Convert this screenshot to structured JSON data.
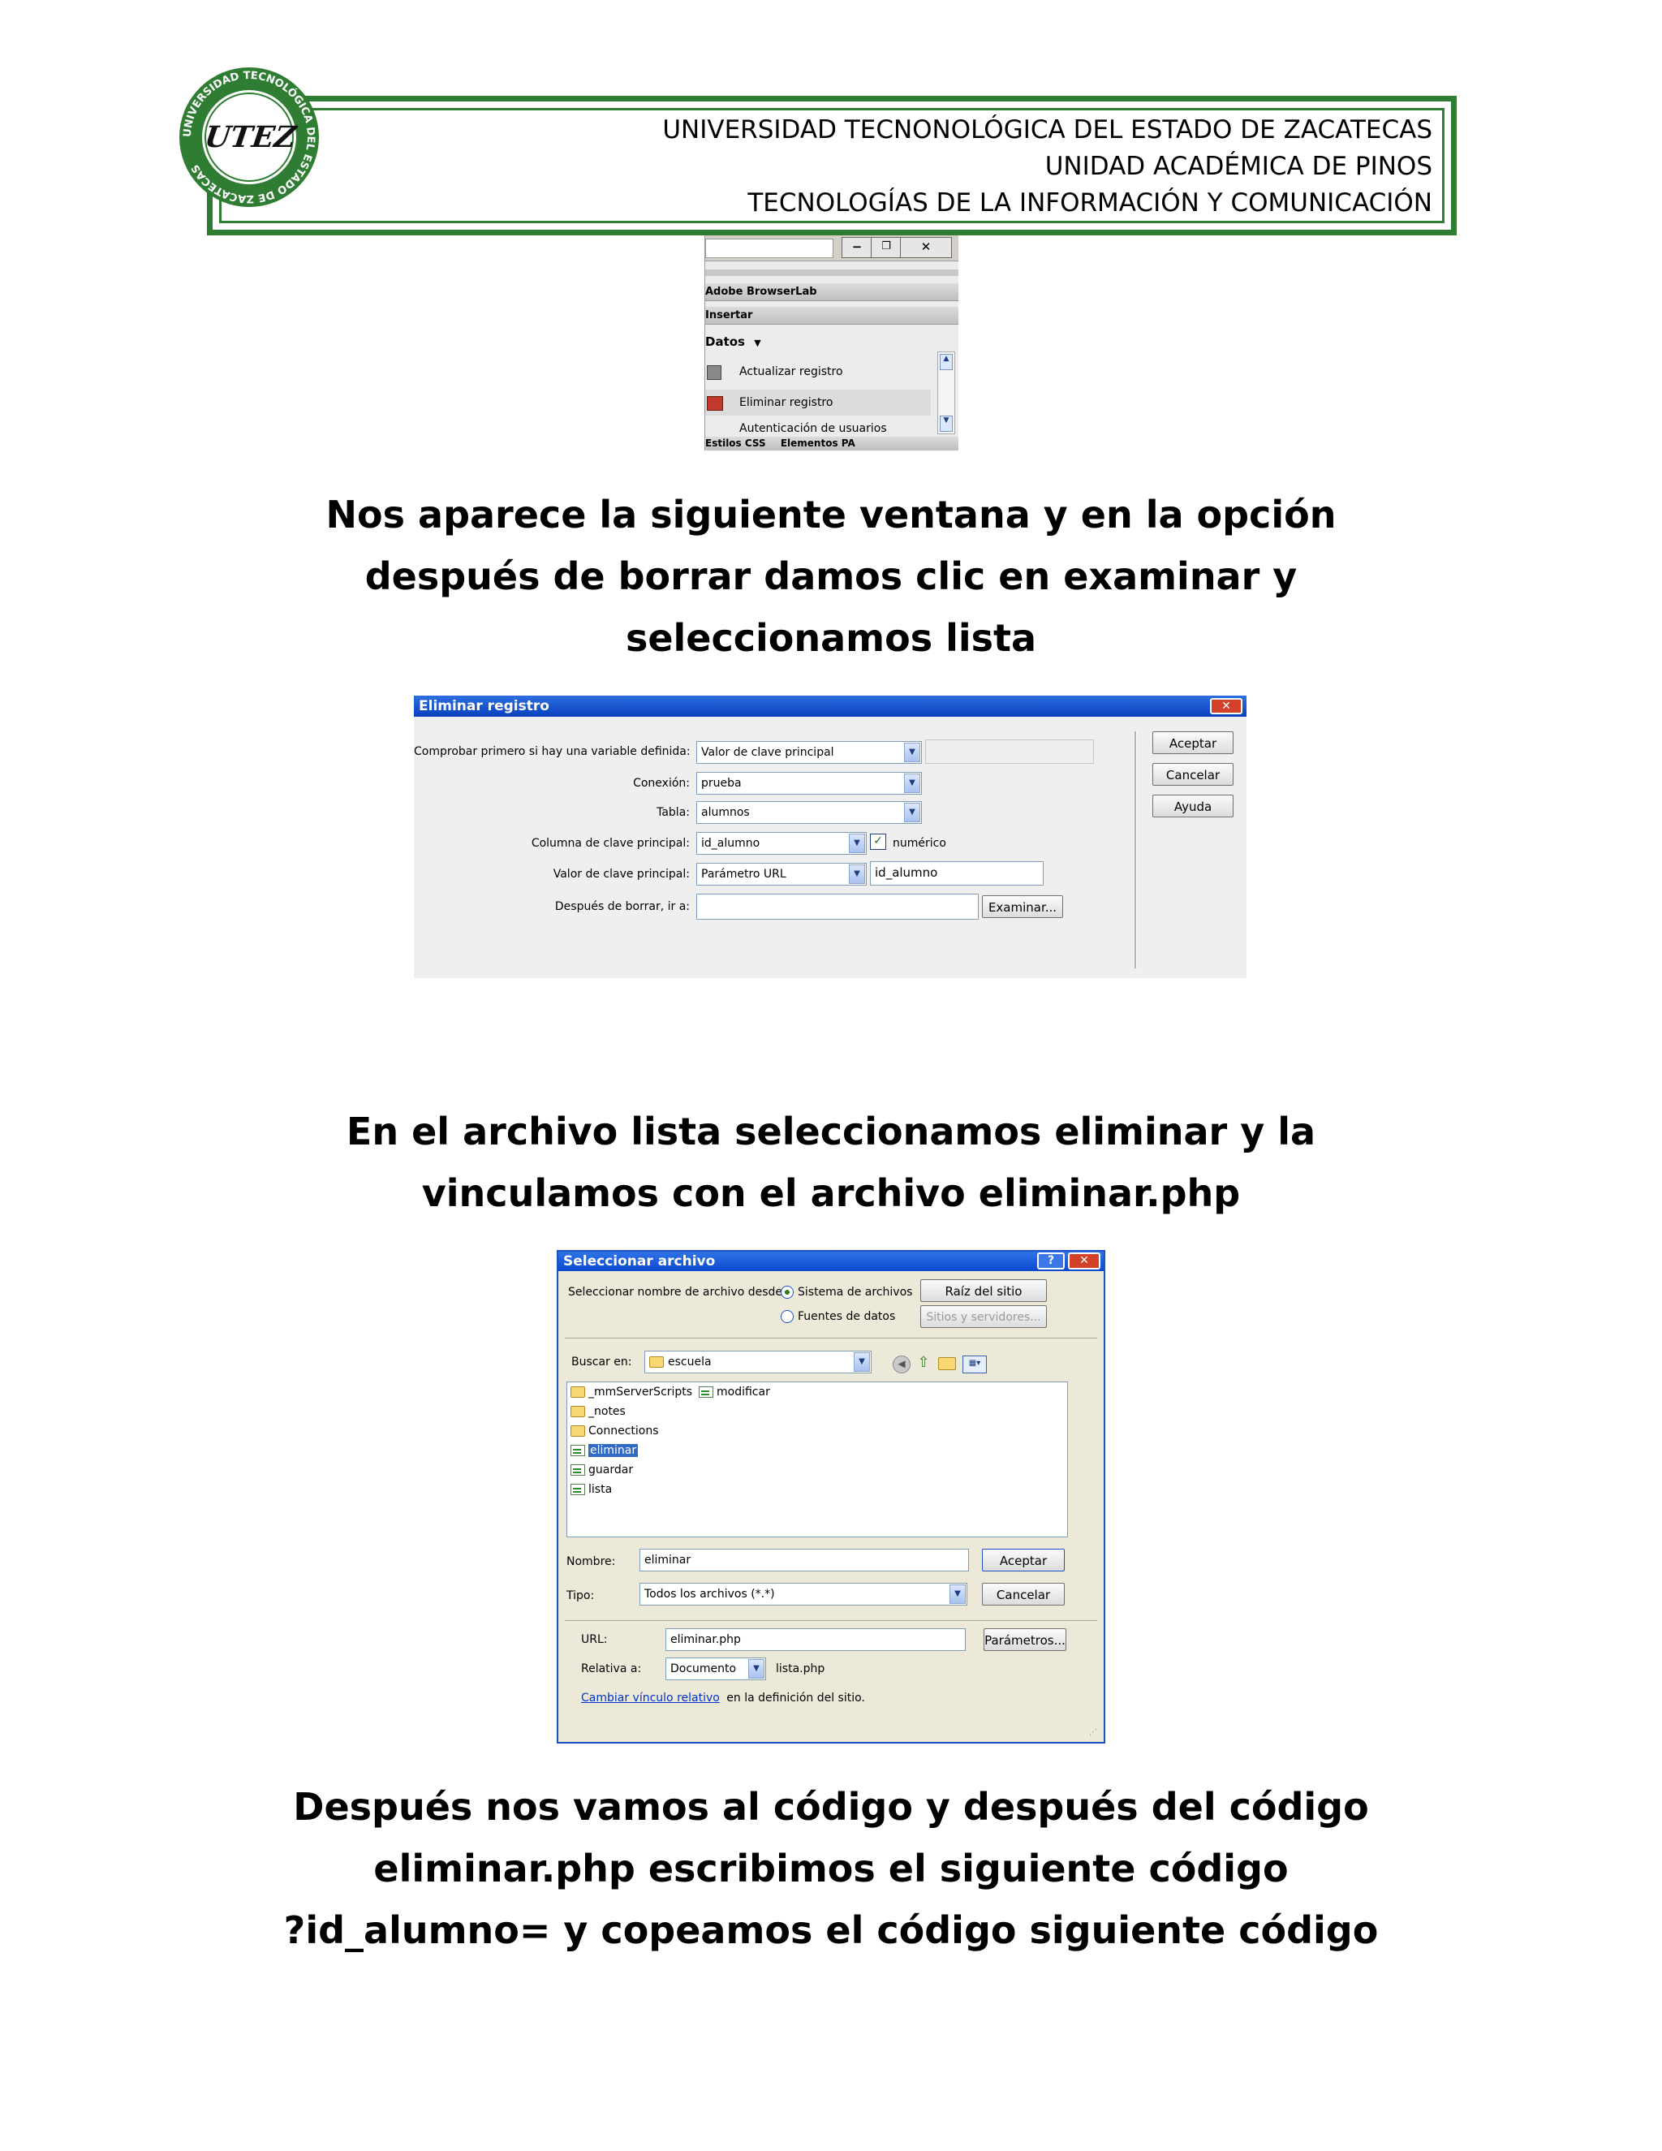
{
  "header": {
    "line1": "UNIVERSIDAD TECNONOLÓGICA DEL ESTADO DE ZACATECAS",
    "line2": "UNIDAD ACADÉMICA DE PINOS",
    "line3": "TECNOLOGÍAS DE LA INFORMACIÓN Y COMUNICACIÓN",
    "logo_ring_text": "UNIVERSIDAD TECNOLÓGICA DEL ESTADO DE ZACATECAS",
    "logo_text": "UTEZ",
    "accent_color": "#2e7d32"
  },
  "panel": {
    "browserlab": "Adobe BrowserLab",
    "insertar": "Insertar",
    "datos": "Datos",
    "items": [
      "Actualizar registro",
      "Eliminar registro",
      "Autenticación de usuarios"
    ],
    "tabs": [
      "Estilos CSS",
      "Elementos PA"
    ]
  },
  "paragraphs": {
    "p1": [
      "Nos  aparece la  siguiente   ventana y  en la  opción",
      "después de  borrar damos clic  en examinar y",
      "seleccionamos lista"
    ],
    "p2": [
      "En el archivo  lista  seleccionamos eliminar  y  la",
      "vinculamos   con el  archivo eliminar.php"
    ],
    "p3": [
      "Después nos   vamos al  código y  después  del  código",
      "eliminar.php escribimos  el siguiente  código",
      "?id_alumno= y  copeamos  el  código  siguiente  código"
    ]
  },
  "dialog1": {
    "title": "Eliminar registro",
    "labels": {
      "check_var": "Comprobar primero si hay una variable definida:",
      "conexion": "Conexión:",
      "tabla": "Tabla:",
      "columna": "Columna de clave principal:",
      "valor": "Valor de clave principal:",
      "despues": "Después de borrar, ir a:"
    },
    "values": {
      "check_var": "Valor de clave principal",
      "conexion": "prueba",
      "tabla": "alumnos",
      "columna": "id_alumno",
      "numerico": "numérico",
      "valor": "Parámetro URL",
      "valor_param": "id_alumno",
      "despues": ""
    },
    "buttons": {
      "examinar": "Examinar...",
      "aceptar": "Aceptar",
      "cancelar": "Cancelar",
      "ayuda": "Ayuda"
    }
  },
  "dialog2": {
    "title": "Seleccionar archivo",
    "seleccionar_desde": "Seleccionar nombre de archivo desde:",
    "radio_sistema": "Sistema de archivos",
    "radio_fuentes": "Fuentes de datos",
    "btn_raiz": "Raíz del sitio",
    "btn_sitios": "Sitios y servidores...",
    "buscar_en": "Buscar en:",
    "buscar_valor": "escuela",
    "files_col1": [
      "_mmServerScripts",
      "_notes",
      "Connections",
      "eliminar",
      "guardar",
      "lista"
    ],
    "files_col2": [
      "modificar"
    ],
    "selected_file": "eliminar",
    "nombre_label": "Nombre:",
    "nombre_valor": "eliminar",
    "tipo_label": "Tipo:",
    "tipo_valor": "Todos los archivos (*.*)",
    "btn_aceptar": "Aceptar",
    "btn_cancelar": "Cancelar",
    "url_label": "URL:",
    "url_valor": "eliminar.php",
    "btn_parametros": "Parámetros...",
    "relativa_label": "Relativa a:",
    "relativa_valor": "Documento",
    "relativa_archivo": "lista.php",
    "cambiar_link": "Cambiar vínculo relativo",
    "cambiar_resto": "en la definición del sitio."
  }
}
